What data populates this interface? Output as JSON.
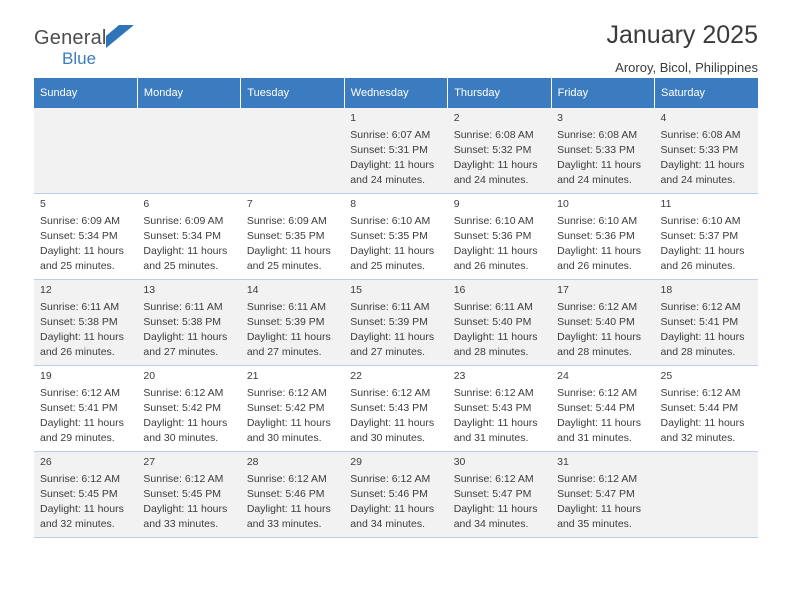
{
  "brand": {
    "name_top": "General",
    "name_bottom": "Blue",
    "flag_icon": "flag-icon",
    "accent_color": "#3b7cc0"
  },
  "header": {
    "month_title": "January 2025",
    "location": "Aroroy, Bicol, Philippines"
  },
  "calendar": {
    "weekday_headers": [
      "Sunday",
      "Monday",
      "Tuesday",
      "Wednesday",
      "Thursday",
      "Friday",
      "Saturday"
    ],
    "weeks": [
      [
        {
          "day": "",
          "lines": []
        },
        {
          "day": "",
          "lines": []
        },
        {
          "day": "",
          "lines": []
        },
        {
          "day": "1",
          "lines": [
            "Sunrise: 6:07 AM",
            "Sunset: 5:31 PM",
            "Daylight: 11 hours",
            "and 24 minutes."
          ]
        },
        {
          "day": "2",
          "lines": [
            "Sunrise: 6:08 AM",
            "Sunset: 5:32 PM",
            "Daylight: 11 hours",
            "and 24 minutes."
          ]
        },
        {
          "day": "3",
          "lines": [
            "Sunrise: 6:08 AM",
            "Sunset: 5:33 PM",
            "Daylight: 11 hours",
            "and 24 minutes."
          ]
        },
        {
          "day": "4",
          "lines": [
            "Sunrise: 6:08 AM",
            "Sunset: 5:33 PM",
            "Daylight: 11 hours",
            "and 24 minutes."
          ]
        }
      ],
      [
        {
          "day": "5",
          "lines": [
            "Sunrise: 6:09 AM",
            "Sunset: 5:34 PM",
            "Daylight: 11 hours",
            "and 25 minutes."
          ]
        },
        {
          "day": "6",
          "lines": [
            "Sunrise: 6:09 AM",
            "Sunset: 5:34 PM",
            "Daylight: 11 hours",
            "and 25 minutes."
          ]
        },
        {
          "day": "7",
          "lines": [
            "Sunrise: 6:09 AM",
            "Sunset: 5:35 PM",
            "Daylight: 11 hours",
            "and 25 minutes."
          ]
        },
        {
          "day": "8",
          "lines": [
            "Sunrise: 6:10 AM",
            "Sunset: 5:35 PM",
            "Daylight: 11 hours",
            "and 25 minutes."
          ]
        },
        {
          "day": "9",
          "lines": [
            "Sunrise: 6:10 AM",
            "Sunset: 5:36 PM",
            "Daylight: 11 hours",
            "and 26 minutes."
          ]
        },
        {
          "day": "10",
          "lines": [
            "Sunrise: 6:10 AM",
            "Sunset: 5:36 PM",
            "Daylight: 11 hours",
            "and 26 minutes."
          ]
        },
        {
          "day": "11",
          "lines": [
            "Sunrise: 6:10 AM",
            "Sunset: 5:37 PM",
            "Daylight: 11 hours",
            "and 26 minutes."
          ]
        }
      ],
      [
        {
          "day": "12",
          "lines": [
            "Sunrise: 6:11 AM",
            "Sunset: 5:38 PM",
            "Daylight: 11 hours",
            "and 26 minutes."
          ]
        },
        {
          "day": "13",
          "lines": [
            "Sunrise: 6:11 AM",
            "Sunset: 5:38 PM",
            "Daylight: 11 hours",
            "and 27 minutes."
          ]
        },
        {
          "day": "14",
          "lines": [
            "Sunrise: 6:11 AM",
            "Sunset: 5:39 PM",
            "Daylight: 11 hours",
            "and 27 minutes."
          ]
        },
        {
          "day": "15",
          "lines": [
            "Sunrise: 6:11 AM",
            "Sunset: 5:39 PM",
            "Daylight: 11 hours",
            "and 27 minutes."
          ]
        },
        {
          "day": "16",
          "lines": [
            "Sunrise: 6:11 AM",
            "Sunset: 5:40 PM",
            "Daylight: 11 hours",
            "and 28 minutes."
          ]
        },
        {
          "day": "17",
          "lines": [
            "Sunrise: 6:12 AM",
            "Sunset: 5:40 PM",
            "Daylight: 11 hours",
            "and 28 minutes."
          ]
        },
        {
          "day": "18",
          "lines": [
            "Sunrise: 6:12 AM",
            "Sunset: 5:41 PM",
            "Daylight: 11 hours",
            "and 28 minutes."
          ]
        }
      ],
      [
        {
          "day": "19",
          "lines": [
            "Sunrise: 6:12 AM",
            "Sunset: 5:41 PM",
            "Daylight: 11 hours",
            "and 29 minutes."
          ]
        },
        {
          "day": "20",
          "lines": [
            "Sunrise: 6:12 AM",
            "Sunset: 5:42 PM",
            "Daylight: 11 hours",
            "and 30 minutes."
          ]
        },
        {
          "day": "21",
          "lines": [
            "Sunrise: 6:12 AM",
            "Sunset: 5:42 PM",
            "Daylight: 11 hours",
            "and 30 minutes."
          ]
        },
        {
          "day": "22",
          "lines": [
            "Sunrise: 6:12 AM",
            "Sunset: 5:43 PM",
            "Daylight: 11 hours",
            "and 30 minutes."
          ]
        },
        {
          "day": "23",
          "lines": [
            "Sunrise: 6:12 AM",
            "Sunset: 5:43 PM",
            "Daylight: 11 hours",
            "and 31 minutes."
          ]
        },
        {
          "day": "24",
          "lines": [
            "Sunrise: 6:12 AM",
            "Sunset: 5:44 PM",
            "Daylight: 11 hours",
            "and 31 minutes."
          ]
        },
        {
          "day": "25",
          "lines": [
            "Sunrise: 6:12 AM",
            "Sunset: 5:44 PM",
            "Daylight: 11 hours",
            "and 32 minutes."
          ]
        }
      ],
      [
        {
          "day": "26",
          "lines": [
            "Sunrise: 6:12 AM",
            "Sunset: 5:45 PM",
            "Daylight: 11 hours",
            "and 32 minutes."
          ]
        },
        {
          "day": "27",
          "lines": [
            "Sunrise: 6:12 AM",
            "Sunset: 5:45 PM",
            "Daylight: 11 hours",
            "and 33 minutes."
          ]
        },
        {
          "day": "28",
          "lines": [
            "Sunrise: 6:12 AM",
            "Sunset: 5:46 PM",
            "Daylight: 11 hours",
            "and 33 minutes."
          ]
        },
        {
          "day": "29",
          "lines": [
            "Sunrise: 6:12 AM",
            "Sunset: 5:46 PM",
            "Daylight: 11 hours",
            "and 34 minutes."
          ]
        },
        {
          "day": "30",
          "lines": [
            "Sunrise: 6:12 AM",
            "Sunset: 5:47 PM",
            "Daylight: 11 hours",
            "and 34 minutes."
          ]
        },
        {
          "day": "31",
          "lines": [
            "Sunrise: 6:12 AM",
            "Sunset: 5:47 PM",
            "Daylight: 11 hours",
            "and 35 minutes."
          ]
        },
        {
          "day": "",
          "lines": []
        }
      ]
    ]
  }
}
